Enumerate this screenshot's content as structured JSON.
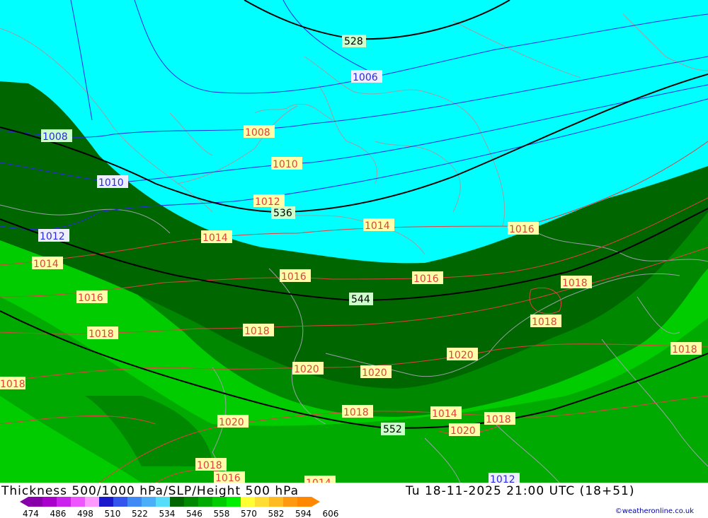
{
  "title_left": "Thickness 500/1000 hPa/SLP/Height 500 hPa",
  "title_right": "Tu 18-11-2025 21:00 UTC (18+51)",
  "credit": "©weatheronline.co.uk",
  "scale": {
    "ticks": [
      "474",
      "486",
      "498",
      "510",
      "522",
      "534",
      "546",
      "558",
      "570",
      "582",
      "594",
      "606"
    ],
    "colors": [
      "#8800aa",
      "#aa00cc",
      "#cc22ee",
      "#ee55ff",
      "#ff99ff",
      "#1a1acc",
      "#3355ee",
      "#3f8af5",
      "#4aaef8",
      "#55ddfa",
      "#006600",
      "#008800",
      "#00aa00",
      "#00cc00",
      "#00ee00",
      "#ffff33",
      "#ffdd33",
      "#ffbb22",
      "#ff9911",
      "#ff8800"
    ]
  },
  "height_labels": [
    "528",
    "536",
    "544",
    "552"
  ],
  "pressure_labels_blue": [
    "1006",
    "1008",
    "1010",
    "1012",
    "1012"
  ],
  "pressure_labels_red": [
    "1008",
    "1010",
    "1012",
    "1014",
    "1014",
    "1014",
    "1016",
    "1016",
    "1016",
    "1016",
    "1018",
    "1018",
    "1018",
    "1018",
    "1018",
    "1018",
    "1018",
    "1018",
    "1018",
    "1020",
    "1020",
    "1020",
    "1020",
    "1020",
    "1014",
    "1016",
    "1014"
  ],
  "colors": {
    "cyan": "#00ffff",
    "dark_green": "#006600",
    "mid_green": "#008800",
    "green": "#00aa00",
    "bright_green": "#00cc00",
    "isobar_red": "#e04040",
    "isobar_blue": "#2a2adf",
    "height_contour": "#000000"
  }
}
